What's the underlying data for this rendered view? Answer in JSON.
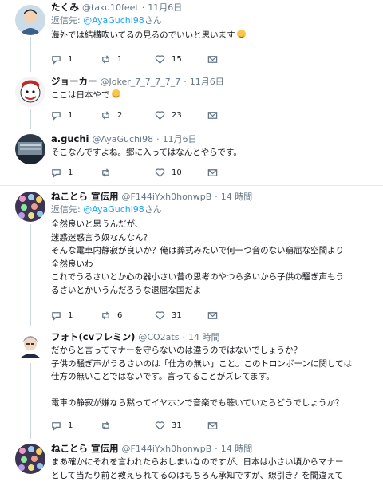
{
  "tweets": [
    {
      "name": "たくみ",
      "handle": "@taku10feet",
      "time": "11月6日",
      "reply_prefix": "返信先: ",
      "reply_to": "@AyaGuchi98",
      "reply_suffix": "さん",
      "text": [
        "海外では結構吹いてるの見るのでいいと思います"
      ],
      "emoji": "smiling-face",
      "replies": "1",
      "retweets": "1",
      "likes": "15"
    },
    {
      "name": "ジョーカー",
      "handle": "@Joker_7_7_7_7_7",
      "time": "11月6日",
      "text": [
        "ここは日本やで"
      ],
      "emoji": "smiling-face",
      "replies": "1",
      "retweets": "2",
      "likes": "23"
    },
    {
      "name": "a.guchi",
      "handle": "@AyaGuchi98",
      "time": "11月6日",
      "text": [
        "そこなんですよね。郷に入ってはなんとやらです。"
      ],
      "replies": "1",
      "retweets": "",
      "likes": "10"
    },
    {
      "name": "ねことら 宣伝用",
      "handle": "@F144iYxh0honwpB",
      "time": "14 時間",
      "reply_prefix": "返信先: ",
      "reply_to": "@AyaGuchi98",
      "reply_suffix": "さん",
      "text": [
        "全然良いと思うんだが、",
        "迷惑迷惑言う奴なんなん？",
        "そんな電車内静寂が良いか？俺は葬式みたいで何一つ音のない窮屈な空間より",
        "全然良いわ",
        "これでうるさいとか心の器小さい昔の思考のやつら多いから子供の騒ぎ声もう",
        "るさいとかいうんだろうな退屈な国だよ"
      ],
      "replies": "1",
      "retweets": "6",
      "likes": "31"
    },
    {
      "name": "フォト(cvフレミン)",
      "handle": "@CO2ats",
      "time": "14 時間",
      "text": [
        "だからと言ってマナーを守らないのは違うのではないでしょうか？",
        "子供の騒ぎ声がうるさいのは「仕方の無い」こと。このトロンボーンに関しては",
        "仕方の無いことではないです。言ってることがズレてます。",
        "",
        "電車の静寂が嫌なら黙ってイヤホンで音楽でも聴いていたらどうでしょうか？"
      ],
      "replies": "1",
      "retweets": "",
      "likes": "31"
    },
    {
      "name": "ねことら 宣伝用",
      "handle": "@F144iYxh0honwpB",
      "time": "14 時間",
      "text": [
        "まあ確かにそれを言われたらおしまいなのですが、日本は小さい頃からマナー",
        "として当たり前と教えられてるのはもちろん承知ですが、線引き？を間違えて"
      ]
    }
  ],
  "sep": "·",
  "colors": {
    "link": "#1da1f2",
    "muted": "#657786",
    "border": "#e6ecf0",
    "thread_line": "#ccd6dd"
  },
  "icons": [
    "reply-icon",
    "retweet-icon",
    "like-icon",
    "dm-icon"
  ]
}
